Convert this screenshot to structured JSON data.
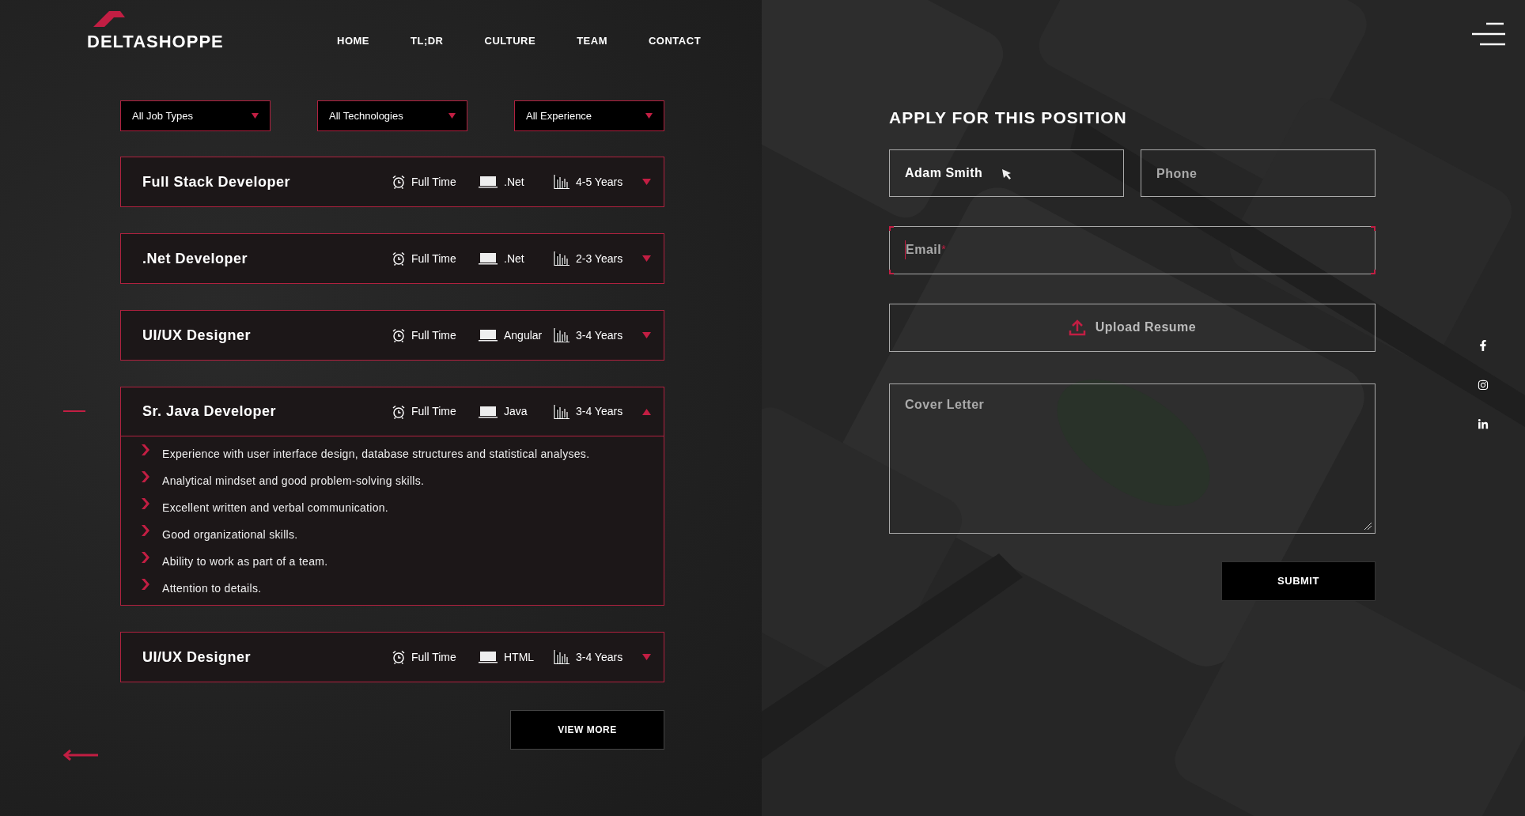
{
  "logo": "DELTASHOPPE",
  "nav": [
    "HOME",
    "TL;DR",
    "CULTURE",
    "TEAM",
    "CONTACT"
  ],
  "filters": [
    {
      "label": "All Job Types"
    },
    {
      "label": "All Technologies"
    },
    {
      "label": "All Experience"
    }
  ],
  "jobs": [
    {
      "title": "Full Stack Developer",
      "type": "Full Time",
      "technology": ".Net",
      "experience": "4-5 Years",
      "expanded": false
    },
    {
      "title": ".Net Developer",
      "type": "Full Time",
      "technology": ".Net",
      "experience": "2-3 Years",
      "expanded": false
    },
    {
      "title": "UI/UX Designer",
      "type": "Full Time",
      "technology": "Angular",
      "experience": "3-4 Years",
      "expanded": false
    },
    {
      "title": "Sr. Java Developer",
      "type": "Full Time",
      "technology": "Java",
      "experience": "3-4 Years",
      "expanded": true,
      "details": [
        "Experience with user interface design, database structures and statistical analyses.",
        "Analytical mindset and good problem-solving skills.",
        "Excellent written and verbal communication.",
        "Good organizational skills.",
        "Ability to work as part of a team.",
        "Attention to details."
      ]
    },
    {
      "title": "UI/UX Designer",
      "type": "Full Time",
      "technology": "HTML",
      "experience": "3-4 Years",
      "expanded": false
    }
  ],
  "view_more": "VIEW MORE",
  "form": {
    "title": "APPLY FOR THIS POSITION",
    "name": {
      "value": "Adam Smith",
      "focused": false
    },
    "phone": {
      "placeholder": "Phone",
      "focused": false
    },
    "email": {
      "placeholder": "Email",
      "required_mark": "*",
      "focused": true
    },
    "upload": "Upload Resume",
    "cover_letter": {
      "placeholder": "Cover Letter"
    },
    "submit": "SUBMIT"
  }
}
